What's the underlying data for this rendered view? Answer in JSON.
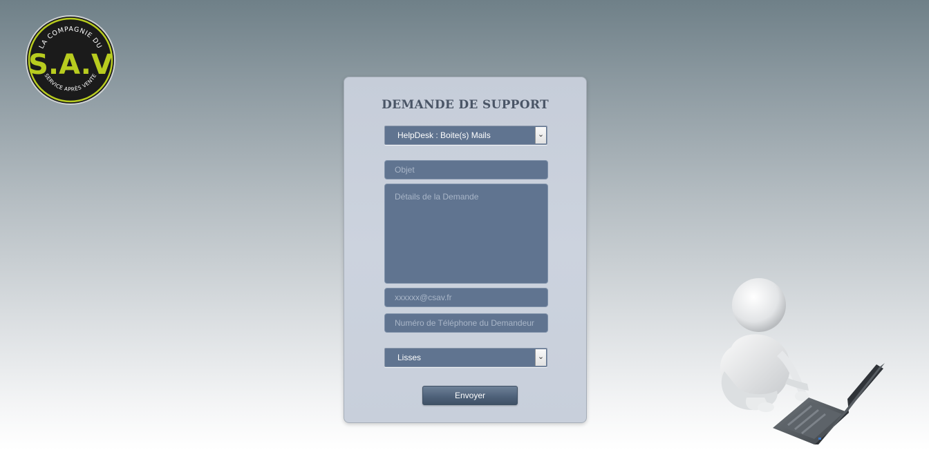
{
  "logo": {
    "top_text": "LA COMPAGNIE DU",
    "mark": "S.A.V",
    "bottom_text": "SERVICE APRÈS VENTE",
    "colors": {
      "ring": "#1a1a1a",
      "accent": "#b8cc1f"
    }
  },
  "form": {
    "title": "DEMANDE DE SUPPORT",
    "category_select": {
      "value": "HelpDesk : Boite(s) Mails",
      "icon": "chevron-down-icon"
    },
    "object_input": {
      "placeholder": "Objet",
      "value": ""
    },
    "details_textarea": {
      "placeholder": "Détails de la Demande",
      "value": ""
    },
    "email_input": {
      "placeholder": "xxxxxx@csav.fr",
      "value": ""
    },
    "phone_input": {
      "placeholder": "Numéro de Téléphone du Demandeur",
      "value": ""
    },
    "site_select": {
      "value": "Lisses",
      "icon": "chevron-down-icon"
    },
    "submit_label": "Envoyer"
  },
  "illustration": {
    "name": "3d-person-laptop"
  },
  "colors": {
    "field_bg": "#607490",
    "card_bg": "#ccd3de",
    "button_bg": "#4f627a",
    "title": "#4a5566"
  }
}
